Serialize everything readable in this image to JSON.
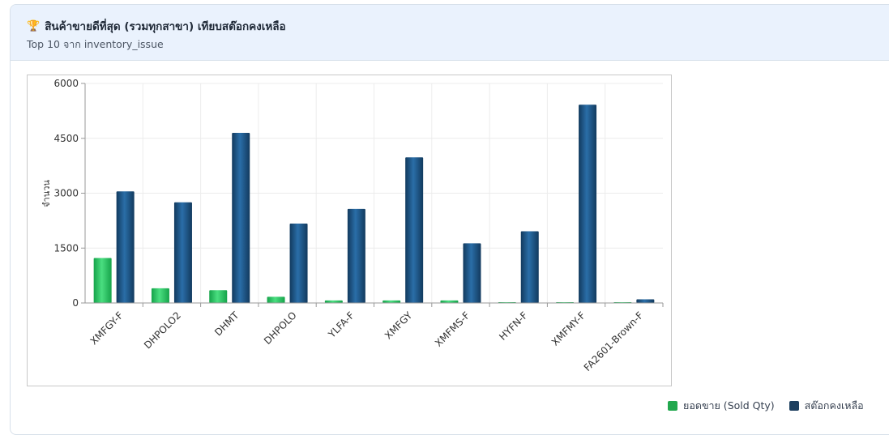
{
  "card": {
    "icon": "trophy-icon",
    "title": "สินค้าขายดีที่สุด (รวมทุกสาขา) เทียบสต๊อกคงเหลือ",
    "subtitle": "Top 10 จาก inventory_issue"
  },
  "chart_data": {
    "type": "bar",
    "title": "",
    "xlabel": "",
    "ylabel": "จำนวน",
    "ylim": [
      0,
      6000
    ],
    "yticks": [
      0,
      1500,
      3000,
      4500,
      6000
    ],
    "grid": true,
    "legend_position": "bottom-right",
    "categories": [
      "XMFGY-F",
      "DHPOLO2",
      "DHMT",
      "DHPOLO",
      "YLFA-F",
      "XMFGY",
      "XMFMS-F",
      "HYFN-F",
      "XMFMY-F",
      "FA2601-Brown-F"
    ],
    "series": [
      {
        "name": "ยอดขาย (Sold Qty)",
        "color": "#22c55e",
        "values": [
          1230,
          400,
          350,
          170,
          70,
          70,
          70,
          20,
          20,
          5
        ]
      },
      {
        "name": "สต๊อกคงเหลือ",
        "color": "#1d4e79",
        "values": [
          3050,
          2750,
          4650,
          2170,
          2570,
          3980,
          1630,
          1960,
          5420,
          100
        ]
      }
    ]
  }
}
